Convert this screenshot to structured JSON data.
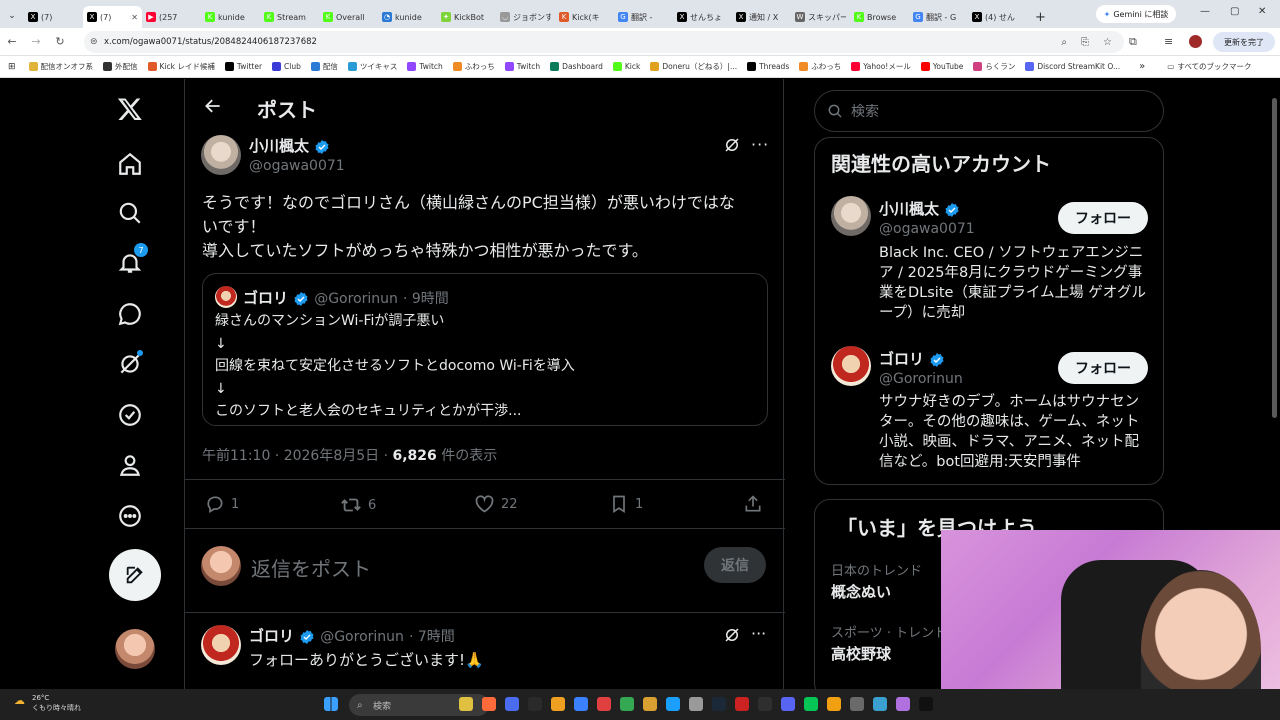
{
  "browser": {
    "tabs": [
      {
        "label": "(7)",
        "color": "#000000",
        "glyph": "X"
      },
      {
        "label": "(7)",
        "color": "#000000",
        "glyph": "X",
        "active": true
      },
      {
        "label": "(257",
        "color": "#ff0033",
        "glyph": "▶"
      },
      {
        "label": "kunide",
        "color": "#53fc18",
        "glyph": "K"
      },
      {
        "label": "Stream",
        "color": "#53fc18",
        "glyph": "K"
      },
      {
        "label": "Overall",
        "color": "#53fc18",
        "glyph": "K"
      },
      {
        "label": "kunide",
        "color": "#2b7bd6",
        "glyph": "◔"
      },
      {
        "label": "KickBot",
        "color": "#7fd43b",
        "glyph": "✦"
      },
      {
        "label": "ジョボンす",
        "color": "#999999",
        "glyph": "◡"
      },
      {
        "label": "Kick(キ",
        "color": "#e05a2a",
        "glyph": "K"
      },
      {
        "label": "翻訳 -",
        "color": "#4285f4",
        "glyph": "G"
      },
      {
        "label": "せんちょ",
        "color": "#000000",
        "glyph": "X"
      },
      {
        "label": "通知 / X",
        "color": "#000000",
        "glyph": "X"
      },
      {
        "label": "スキッパー",
        "color": "#666666",
        "glyph": "W"
      },
      {
        "label": "Browse",
        "color": "#53fc18",
        "glyph": "K"
      },
      {
        "label": "翻訳 - G",
        "color": "#4285f4",
        "glyph": "G"
      },
      {
        "label": "(4) せん",
        "color": "#000000",
        "glyph": "X"
      }
    ],
    "new_tab": "+",
    "gemini_label": "Gemini に相談",
    "url": "x.com/ogawa0071/status/2084824406187237682",
    "update_label": "更新を完了",
    "bookmarks": [
      {
        "label": "配信オンオフ系",
        "color": "#e0b43a"
      },
      {
        "label": "外配信",
        "color": "#333333"
      },
      {
        "label": "Kick レイド候補",
        "color": "#e05a2a"
      },
      {
        "label": "Twitter",
        "color": "#000000"
      },
      {
        "label": "Club",
        "color": "#3a3ad6"
      },
      {
        "label": "配信",
        "color": "#2b7bd6"
      },
      {
        "label": "ツイキャス",
        "color": "#2b9bd6"
      },
      {
        "label": "Twitch",
        "color": "#9146ff"
      },
      {
        "label": "ふわっち",
        "color": "#f08a24"
      },
      {
        "label": "Twitch",
        "color": "#9146ff"
      },
      {
        "label": "Dashboard",
        "color": "#0a7a5a"
      },
      {
        "label": "Kick",
        "color": "#53fc18"
      },
      {
        "label": "Doneru（どねる）|...",
        "color": "#e0a020"
      },
      {
        "label": "Threads",
        "color": "#000000"
      },
      {
        "label": "ふわっち",
        "color": "#f08a24"
      },
      {
        "label": "Yahoo!メール",
        "color": "#ff0033"
      },
      {
        "label": "YouTube",
        "color": "#ff0000"
      },
      {
        "label": "らくラン",
        "color": "#d04080"
      },
      {
        "label": "Discord StreamKit O...",
        "color": "#5865f2"
      }
    ],
    "all_bookmarks": "すべてのブックマーク"
  },
  "nav": {
    "notification_count": "7"
  },
  "post": {
    "header": "ポスト",
    "author_name": "小川楓太",
    "author_handle": "@ogawa0071",
    "text_line1": "そうです！なのでゴロリさん（横山緑さんのPC担当様）が悪いわけではな",
    "text_line2": "いです！",
    "text_line3": "導入していたソフトがめっちゃ特殊かつ相性が悪かったです。",
    "quote": {
      "name": "ゴロリ",
      "handle": "@Gororinun",
      "time": "· 9時間",
      "lines": [
        "緑さんのマンションWi-Fiが調子悪い",
        "↓",
        "回線を束ねて安定化させるソフトとdocomo Wi-Fiを導入",
        "↓",
        "このソフトと老人会のセキュリティとかが干渉..."
      ]
    },
    "timestamp": "午前11:10 · 2026年8月5日 · ",
    "views": "6,826",
    "views_suffix": " 件の表示",
    "replies": "1",
    "reposts": "6",
    "likes": "22",
    "bookmarks": "1"
  },
  "reply": {
    "placeholder": "返信をポスト",
    "button": "返信"
  },
  "next_reply": {
    "name": "ゴロリ",
    "handle": "@Gororinun",
    "time": "· 7時間",
    "text": "フォローありがとうございます!🙏"
  },
  "sidebar": {
    "search_placeholder": "検索",
    "related_title": "関連性の高いアカウント",
    "accounts": [
      {
        "name": "小川楓太",
        "handle": "@ogawa0071",
        "follow": "フォロー",
        "bio": "Black Inc. CEO / ソフトウェアエンジニア / 2025年8月にクラウドゲーミング事業をDLsite（東証プライム上場 ゲオグループ）に売却"
      },
      {
        "name": "ゴロリ",
        "handle": "@Gororinun",
        "follow": "フォロー",
        "bio": "サウナ好きのデブ。ホームはサウナセンター。その他の趣味は、ゲーム、ネット小説、映画、ドラマ、アニメ、ネット配信など。bot回避用:天安門事件"
      }
    ],
    "trends_title": "「いま」を見つけよう",
    "trends": [
      {
        "category": "日本のトレンド",
        "name": "概念ぬい"
      },
      {
        "category": "スポーツ · トレンド",
        "name": "高校野球"
      }
    ]
  },
  "taskbar": {
    "temp": "26°C",
    "weather": "くもり時々晴れ",
    "search": "検索"
  },
  "colors": {
    "accent": "#1d9bf0",
    "background": "#000000",
    "border": "#2f3336",
    "muted": "#71767b"
  }
}
